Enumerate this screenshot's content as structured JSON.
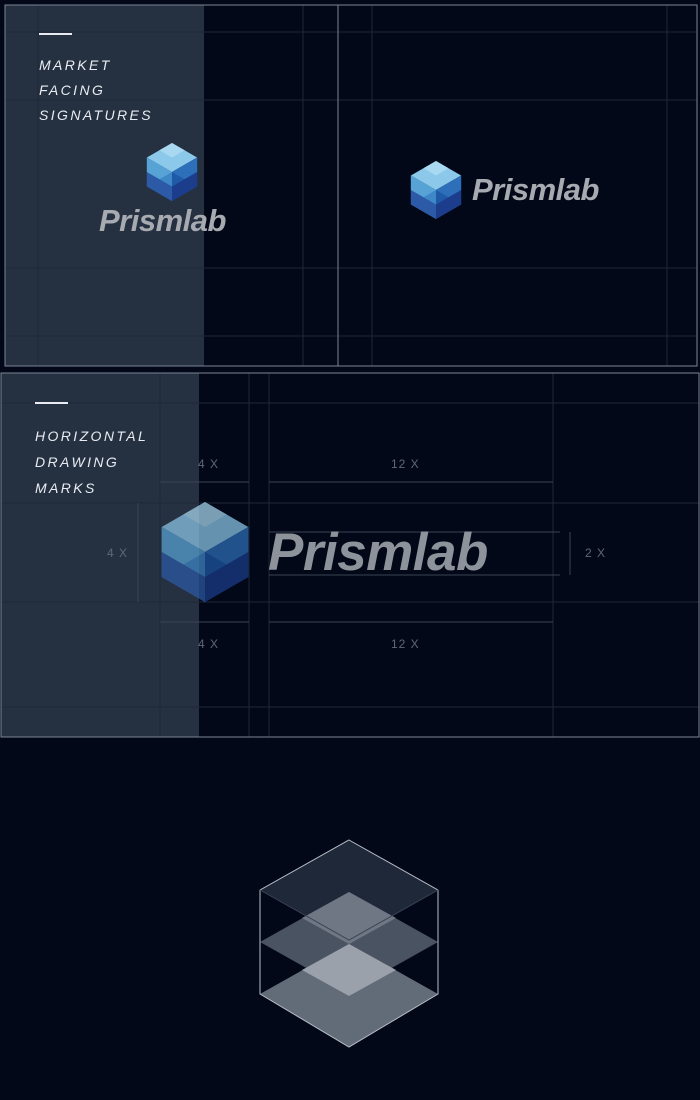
{
  "signatures_panel": {
    "label_lines": [
      "MARKET",
      "FACING",
      "SIGNATURES"
    ],
    "wordmark": "Prismlab",
    "wordmark_color": "#a7abb1"
  },
  "drawing_panel": {
    "label_lines": [
      "HORIZONTAL",
      "DRAWING",
      "MARKS"
    ],
    "wordmark": "Prismlab",
    "dimensions": {
      "top_left": "4 X",
      "top_right": "12 X",
      "left": "4 X",
      "right": "2 X",
      "bottom_left": "4 X",
      "bottom_right": "12 X"
    }
  },
  "colors": {
    "background": "#020817",
    "grid_line": "#1e2838",
    "frame_line": "#7c8593",
    "highlight_column": "#253040",
    "logo_light": "#8cc8ea",
    "logo_mid": "#3f88c8",
    "logo_dark": "#1b3d8c"
  },
  "icons": [
    "prism-logo-icon",
    "prism-outline-icon"
  ]
}
